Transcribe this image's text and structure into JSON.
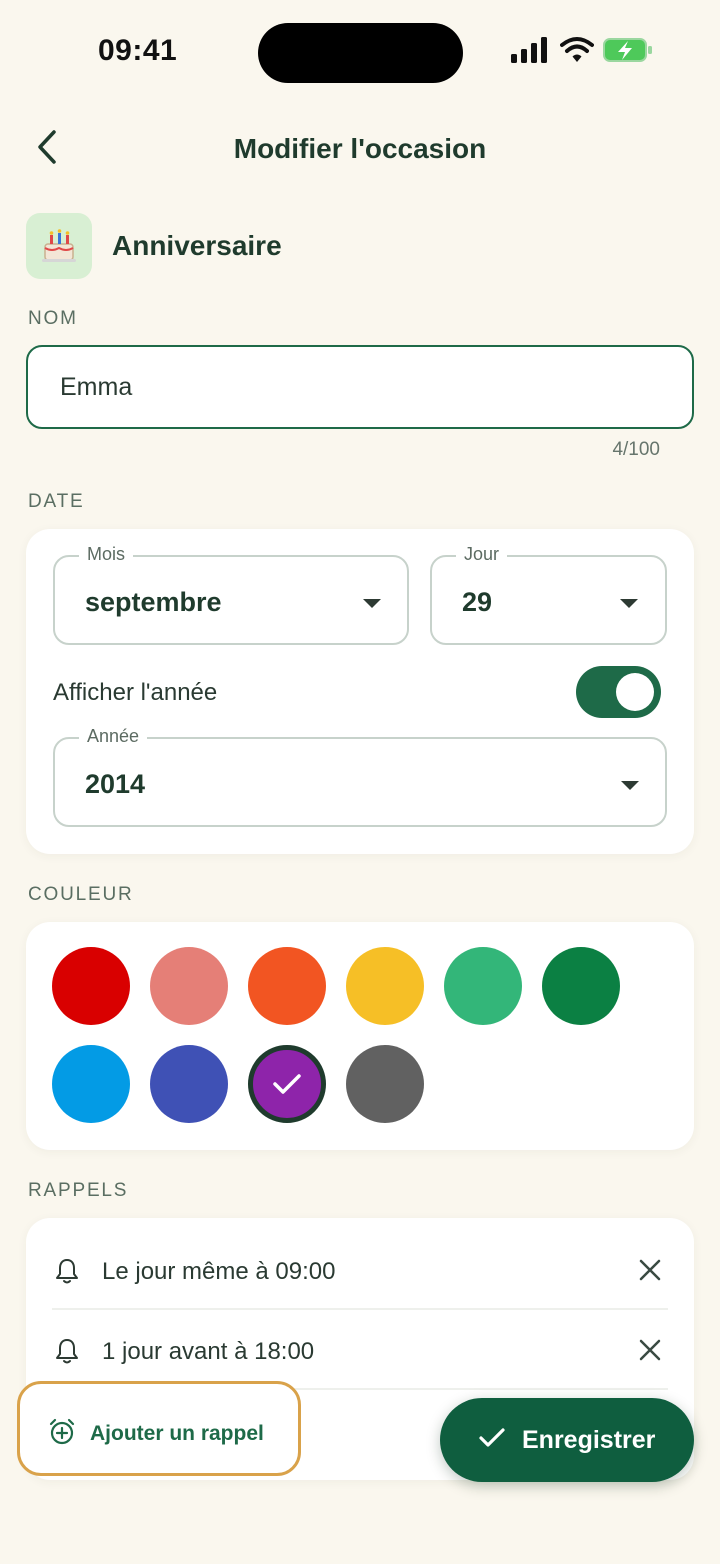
{
  "status_bar": {
    "time": "09:41"
  },
  "header": {
    "title": "Modifier l'occasion"
  },
  "occasion": {
    "type_label": "Anniversaire",
    "type_icon": "birthday-cake-icon"
  },
  "name_section": {
    "label": "NOM",
    "value": "Emma",
    "counter": "4/100"
  },
  "date_section": {
    "label": "DATE",
    "month_label": "Mois",
    "month_value": "septembre",
    "day_label": "Jour",
    "day_value": "29",
    "show_year_label": "Afficher l'année",
    "show_year_on": true,
    "year_label": "Année",
    "year_value": "2014"
  },
  "color_section": {
    "label": "COULEUR",
    "swatches": [
      "#d90000",
      "#e57f77",
      "#f25522",
      "#f6bf26",
      "#33b679",
      "#0b8043",
      "#039be5",
      "#3f51b5",
      "#8e24aa",
      "#616161"
    ],
    "selected_color": "#8e24aa"
  },
  "reminders_section": {
    "label": "RAPPELS",
    "items": [
      {
        "text": "Le jour même à 09:00"
      },
      {
        "text": "1 jour avant à 18:00"
      }
    ],
    "add_label": "Ajouter un rappel"
  },
  "actions": {
    "save_label": "Enregistrer"
  },
  "colors": {
    "primary": "#1e6a48",
    "fab": "#0f5e3f",
    "background": "#faf7ee",
    "highlight": "#d9a24a"
  }
}
